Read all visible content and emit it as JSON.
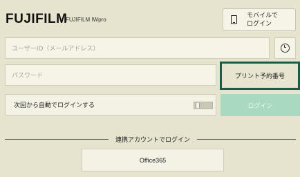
{
  "header": {
    "brand": "FUJIFILM",
    "product": "FUJIFILM IWpro",
    "mobile_login_label": "モバイルで\nログイン",
    "mobile_icon": "phone-icon"
  },
  "form": {
    "userid_placeholder": "ユーザーID（メールアドレス）",
    "history_icon": "history-icon",
    "password_placeholder": "パスワード",
    "print_reservation_label": "プリント予約番号",
    "auto_login_label": "次回から自動でログインする",
    "auto_login_enabled": false,
    "login_label": "ログイン"
  },
  "external": {
    "divider_label": "連携アカウントでログイン",
    "providers": [
      "Office365"
    ]
  },
  "colors": {
    "background": "#e6e4cf",
    "accent": "#1d5b49",
    "login_button": "#a9d9bf"
  }
}
